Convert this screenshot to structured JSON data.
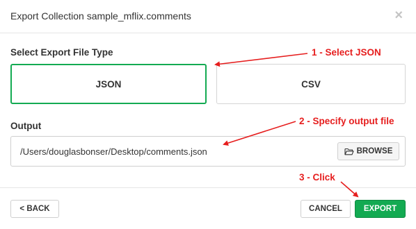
{
  "dialog": {
    "title": "Export Collection sample_mflix.comments",
    "close_glyph": "×"
  },
  "file_type": {
    "label": "Select Export File Type",
    "options": [
      {
        "label": "JSON",
        "selected": true
      },
      {
        "label": "CSV",
        "selected": false
      }
    ]
  },
  "output": {
    "label": "Output",
    "value": "/Users/douglasbonser/Desktop/comments.json",
    "browse_label": "BROWSE",
    "browse_icon": "folder-open-icon"
  },
  "footer": {
    "back_label": "< BACK",
    "cancel_label": "CANCEL",
    "export_label": "EXPORT"
  },
  "annotations": {
    "step1": "1 - Select JSON",
    "step2": "2 - Specify output file",
    "step3": "3 - Click"
  },
  "colors": {
    "accent_green": "#13aa52",
    "annotation_red": "#e61e1e"
  }
}
